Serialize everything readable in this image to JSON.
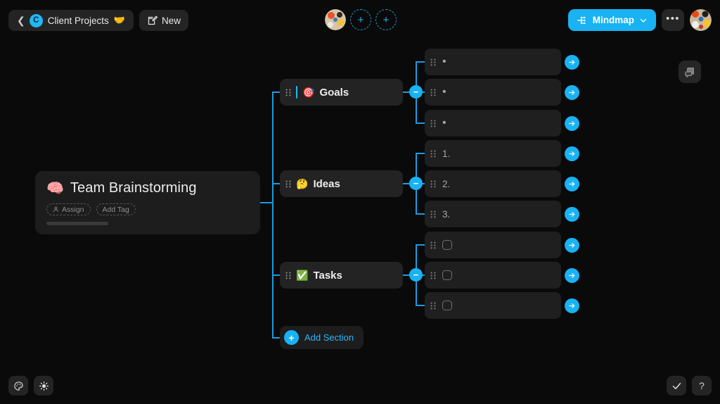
{
  "header": {
    "back_icon": "chevron-left-icon",
    "workspace_initial": "C",
    "workspace_name": "Client Projects",
    "workspace_emoji": "🤝",
    "new_label": "New",
    "new_icon": "new-document-icon",
    "center": {
      "avatar_icon": "collaborator-avatar",
      "add_collaborator_1": "+",
      "add_collaborator_2": "+"
    },
    "view_button": {
      "label": "Mindmap",
      "icon": "mindmap-icon",
      "chevron": "chevron-down-icon",
      "color": "#19b2f3"
    },
    "more_label": "•••",
    "user_avatar_icon": "user-avatar"
  },
  "canvas": {
    "accent_color": "#19b2f3",
    "line_color": "#1b9ce0",
    "root": {
      "emoji": "🧠",
      "title": "Team Brainstorming",
      "chips": [
        {
          "label": "Assign",
          "icon": "person-icon"
        },
        {
          "label": "Add Tag",
          "icon": "tag-icon"
        }
      ]
    },
    "sections": [
      {
        "emoji": "🎯",
        "label": "Goals",
        "collapse_glyph": "−",
        "list_type": "bullet",
        "children": [
          {
            "marker": "•",
            "text": ""
          },
          {
            "marker": "•",
            "text": ""
          },
          {
            "marker": "•",
            "text": ""
          }
        ]
      },
      {
        "emoji": "🤔",
        "label": "Ideas",
        "collapse_glyph": "−",
        "list_type": "number",
        "children": [
          {
            "marker": "1.",
            "text": ""
          },
          {
            "marker": "2.",
            "text": ""
          },
          {
            "marker": "3.",
            "text": ""
          }
        ]
      },
      {
        "emoji": "✅",
        "label": "Tasks",
        "collapse_glyph": "−",
        "list_type": "checkbox",
        "children": [
          {
            "marker": "",
            "text": ""
          },
          {
            "marker": "",
            "text": ""
          },
          {
            "marker": "",
            "text": ""
          }
        ]
      }
    ],
    "add_section": {
      "label": "Add Section",
      "glyph": "+"
    },
    "comments_button_icon": "comments-icon"
  },
  "bottom_left": [
    {
      "icon": "palette-icon",
      "name": "theme-button"
    },
    {
      "icon": "brightness-icon",
      "name": "brightness-button"
    }
  ],
  "bottom_right": [
    {
      "icon": "check-icon",
      "name": "confirm-button",
      "glyph": "✓"
    },
    {
      "icon": "question-icon",
      "name": "help-button",
      "glyph": "?"
    }
  ]
}
